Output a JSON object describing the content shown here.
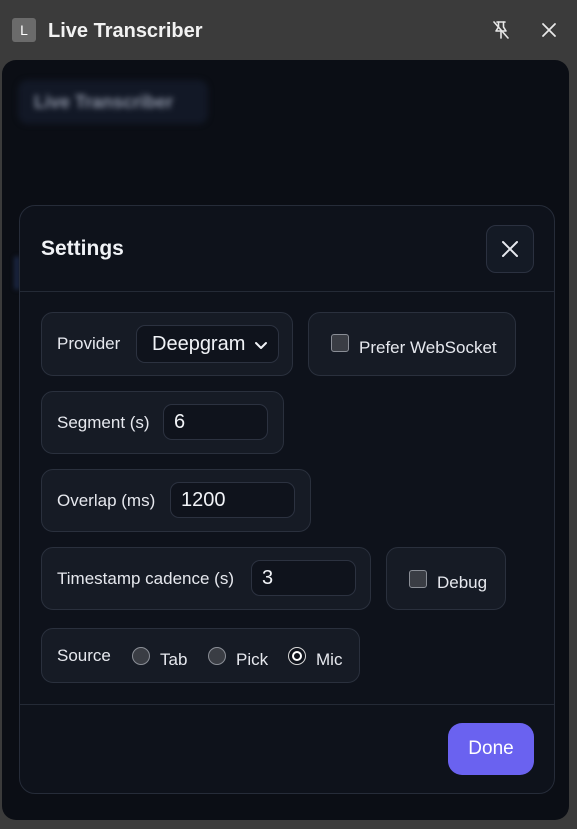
{
  "window": {
    "badge": "L",
    "title": "Live Transcriber",
    "pin_icon": "unpin-icon",
    "close_icon": "close-icon"
  },
  "background": {
    "title": "Live Transcriber"
  },
  "settings": {
    "title": "Settings",
    "close_icon": "close-icon",
    "provider": {
      "label": "Provider",
      "value": "Deepgram"
    },
    "prefer_websocket": {
      "label": "Prefer WebSocket",
      "checked": false
    },
    "segment": {
      "label": "Segment (s)",
      "value": "6"
    },
    "overlap": {
      "label": "Overlap (ms)",
      "value": "1200"
    },
    "timestamp_cadence": {
      "label": "Timestamp cadence (s)",
      "value": "3"
    },
    "debug": {
      "label": "Debug",
      "checked": false
    },
    "source": {
      "label": "Source",
      "options": [
        {
          "label": "Tab",
          "checked": false
        },
        {
          "label": "Pick",
          "checked": false
        },
        {
          "label": "Mic",
          "checked": true
        }
      ]
    },
    "done_label": "Done",
    "accent_color": "#6a62f0"
  }
}
